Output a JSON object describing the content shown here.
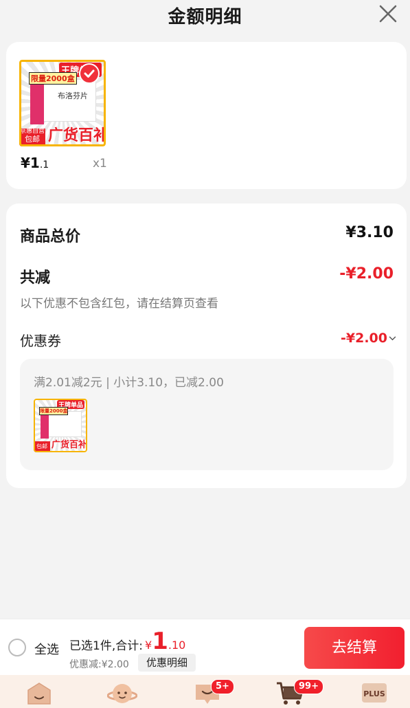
{
  "header": {
    "title": "金额明细"
  },
  "product": {
    "thumb_badge": "王牌单品",
    "thumb_qty": "限量2000盒",
    "thumb_drug": "布洛芬片",
    "thumb_corner_1": "京惠自营",
    "thumb_corner_2": "包邮",
    "thumb_big": "广货百补",
    "price_int": "¥1",
    "price_dec": ".1",
    "qty": "x1"
  },
  "summary": {
    "total_label": "商品总价",
    "total_value": "¥3.10",
    "reduce_label": "共减",
    "reduce_value": "-¥2.00",
    "note": "以下优惠不包含红包，请在结算页查看",
    "coupon_label": "优惠券",
    "coupon_value": "-¥2.00",
    "coupon_desc": "满2.01减2元 | 小计3.10，已减2.00"
  },
  "bottom": {
    "select_all": "全选",
    "selected_text": "已选1件,合计:",
    "total_currency": "¥",
    "total_int": "1",
    "total_dec": ".10",
    "discount": "优惠减:¥2.00",
    "detail_button": "优惠明细",
    "checkout_button": "去结算"
  },
  "tabbar": {
    "messages_badge": "5+",
    "cart_badge": "99+",
    "plus_label": "PLUS"
  },
  "colors": {
    "accent": "#e9202a",
    "tab_bg": "#fbf0e8"
  }
}
